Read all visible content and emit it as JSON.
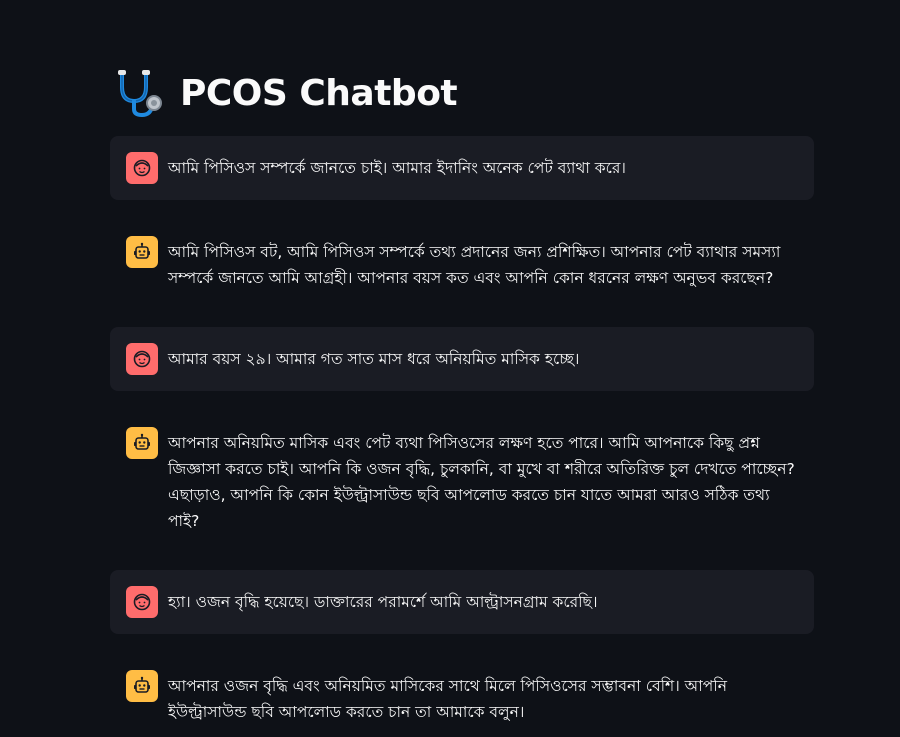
{
  "page": {
    "title": "PCOS Chatbot",
    "title_icon": "stethoscope-icon"
  },
  "messages": [
    {
      "role": "user",
      "avatar_icon": "user-face-icon",
      "text": "আমি পিসিওস সম্পর্কে জানতে চাই। আমার ইদানিং অনেক পেট ব্যাথা করে।"
    },
    {
      "role": "assistant",
      "avatar_icon": "robot-icon",
      "text": "আমি পিসিওস বট, আমি পিসিওস সম্পর্কে তথ্য প্রদানের জন্য প্রশিক্ষিত। আপনার পেট ব্যাথার সমস্যা সম্পর্কে জানতে আমি আগ্রহী। আপনার বয়স কত এবং আপনি কোন ধরনের লক্ষণ অনুভব করছেন?"
    },
    {
      "role": "user",
      "avatar_icon": "user-face-icon",
      "text": "আমার বয়স ২৯। আমার গত সাত মাস ধরে অনিয়মিত মাসিক হচ্ছে।"
    },
    {
      "role": "assistant",
      "avatar_icon": "robot-icon",
      "text": "আপনার অনিয়মিত মাসিক এবং পেট ব্যথা পিসিওসের লক্ষণ হতে পারে। আমি আপনাকে কিছু প্রশ্ন জিজ্ঞাসা করতে চাই। আপনি কি ওজন বৃদ্ধি, চুলকানি, বা মুখে বা শরীরে অতিরিক্ত চুল দেখতে পাচ্ছেন? এছাড়াও, আপনি কি কোন ইউল্ট্রাসাউন্ড ছবি আপলোড করতে চান যাতে আমরা আরও সঠিক তথ্য পাই?"
    },
    {
      "role": "user",
      "avatar_icon": "user-face-icon",
      "text": "হ্যা। ওজন বৃদ্ধি হয়েছে। ডাক্তারের পরামর্শে আমি আল্ট্রাসনগ্রাম করেছি।"
    },
    {
      "role": "assistant",
      "avatar_icon": "robot-icon",
      "text": "আপনার ওজন বৃদ্ধি এবং অনিয়মিত মাসিকের সাথে মিলে পিসিওসের সম্ভাবনা বেশি। আপনি ইউল্ট্রাসাউন্ড ছবি আপলোড করতে চান তা আমাকে বলুন।"
    }
  ],
  "colors": {
    "background": "#0e1117",
    "user_bubble": "#1a1c24",
    "user_avatar": "#ff6c6c",
    "assistant_avatar": "#ffbd45",
    "text": "#fafafa"
  }
}
